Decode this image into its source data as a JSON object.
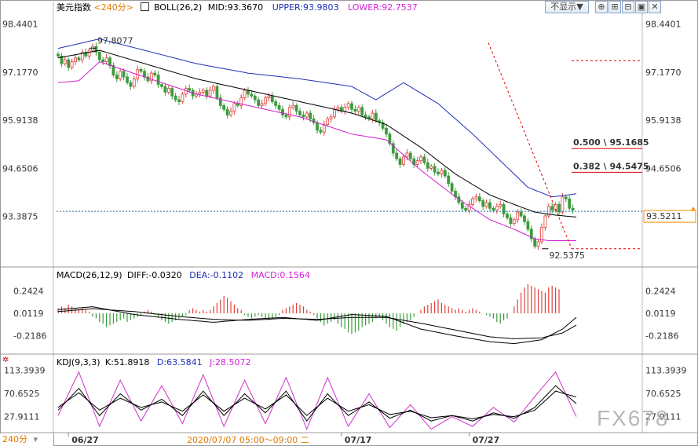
{
  "header": {
    "symbol": "美元指数",
    "period": "<240分>",
    "boll_label": "BOLL(26,2)",
    "mid_label": "MID:93.3670",
    "upper_label": "UPPER:93.9803",
    "lower_label": "LOWER:92.7537",
    "show_button": "不显示▼",
    "tool_icons": [
      "crosshair-icon",
      "zoom-in-icon",
      "zoom-out-icon",
      "window-icon",
      "close-icon"
    ]
  },
  "macd_header": {
    "title": "MACD(26,12,9)",
    "diff": "DIFF:-0.0320",
    "dea": "DEA:-0.1102",
    "macd": "MACD:0.1564"
  },
  "kdj_header": {
    "title": "KDJ(9,3,3)",
    "k": "K:51.8918",
    "d": "D:63.5841",
    "j": "J:28.5072"
  },
  "bottom_bar": {
    "period_button": "240分",
    "time_cursor": "2020/07/07 05:00～09:00 二"
  },
  "watermark": "FX678",
  "colors": {
    "up": "#e0413c",
    "down": "#3c9b3c",
    "mid": "#000000",
    "upper": "#1e2fb5",
    "lower": "#d41fd4",
    "fib": "#e00000",
    "current": "#1d6fa8",
    "current_tag": "#ff8c00",
    "diff": "#000000",
    "dea": "#000000",
    "k": "#000000",
    "d": "#000000",
    "j": "#cc33cc"
  },
  "chart_data": [
    {
      "type": "candlestick",
      "name": "美元指数",
      "ylim": [
        92.1,
        98.7
      ],
      "y_ticks": [
        "98.4401",
        "97.1770",
        "95.9138",
        "94.6506",
        "93.3875"
      ],
      "y_tick_values": [
        98.4401,
        97.177,
        95.9138,
        94.6506,
        93.3875
      ],
      "x_ticks": [
        "06/27",
        "07/17",
        "07/27"
      ],
      "x_tick_index": [
        3,
        82,
        119
      ],
      "closes": [
        97.6,
        97.4,
        97.5,
        97.3,
        97.45,
        97.55,
        97.5,
        97.7,
        97.6,
        97.75,
        97.85,
        97.7,
        97.5,
        97.45,
        97.55,
        97.35,
        97.1,
        97.0,
        97.2,
        97.05,
        96.9,
        96.8,
        97.0,
        97.25,
        97.2,
        97.05,
        96.95,
        97.15,
        97.1,
        96.85,
        96.8,
        96.65,
        96.75,
        96.55,
        96.45,
        96.4,
        96.6,
        96.75,
        96.7,
        96.55,
        96.6,
        96.65,
        96.7,
        96.55,
        96.7,
        96.8,
        96.5,
        96.3,
        96.2,
        96.05,
        96.15,
        96.35,
        96.3,
        96.5,
        96.7,
        96.6,
        96.55,
        96.45,
        96.3,
        96.35,
        96.5,
        96.55,
        96.4,
        96.3,
        96.2,
        96.05,
        96.0,
        96.25,
        96.3,
        96.15,
        96.05,
        96.0,
        96.1,
        95.95,
        95.85,
        95.65,
        95.6,
        95.8,
        95.95,
        96.0,
        96.2,
        96.25,
        96.15,
        96.25,
        96.35,
        96.2,
        96.15,
        96.25,
        96.05,
        96.0,
        95.95,
        96.1,
        95.9,
        95.85,
        95.7,
        95.55,
        95.3,
        95.05,
        94.9,
        94.75,
        94.95,
        95.05,
        94.9,
        94.75,
        94.85,
        94.95,
        94.8,
        94.65,
        94.7,
        94.55,
        94.5,
        94.6,
        94.45,
        94.25,
        94.05,
        93.9,
        93.75,
        93.6,
        93.55,
        93.7,
        93.85,
        93.9,
        93.8,
        93.65,
        93.75,
        93.6,
        93.55,
        93.65,
        93.7,
        93.45,
        93.35,
        93.2,
        93.3,
        93.5,
        93.4,
        93.25,
        93.05,
        92.8,
        92.6,
        92.72,
        93.1,
        93.4,
        93.65,
        93.55,
        93.7,
        93.5,
        93.9,
        93.85,
        93.6,
        93.55
      ],
      "bands": {
        "mid": [
          [
            0,
            97.55
          ],
          [
            12,
            97.75
          ],
          [
            25,
            97.4
          ],
          [
            40,
            97.0
          ],
          [
            55,
            96.7
          ],
          [
            70,
            96.4
          ],
          [
            85,
            96.1
          ],
          [
            95,
            95.8
          ],
          [
            105,
            95.2
          ],
          [
            115,
            94.5
          ],
          [
            125,
            93.95
          ],
          [
            132,
            93.7
          ],
          [
            138,
            93.5
          ],
          [
            144,
            93.42
          ],
          [
            150,
            93.37
          ]
        ],
        "upper": [
          [
            0,
            97.8
          ],
          [
            12,
            98.05
          ],
          [
            25,
            97.75
          ],
          [
            40,
            97.4
          ],
          [
            55,
            97.15
          ],
          [
            70,
            97.0
          ],
          [
            85,
            96.8
          ],
          [
            92,
            96.45
          ],
          [
            100,
            96.9
          ],
          [
            110,
            96.35
          ],
          [
            120,
            95.55
          ],
          [
            128,
            94.85
          ],
          [
            136,
            94.15
          ],
          [
            143,
            93.9
          ],
          [
            150,
            93.98
          ]
        ],
        "lower": [
          [
            0,
            96.9
          ],
          [
            6,
            96.95
          ],
          [
            12,
            97.45
          ],
          [
            25,
            97.05
          ],
          [
            40,
            96.6
          ],
          [
            55,
            96.3
          ],
          [
            70,
            96.0
          ],
          [
            85,
            95.55
          ],
          [
            95,
            95.4
          ],
          [
            105,
            94.6
          ],
          [
            115,
            93.9
          ],
          [
            125,
            93.3
          ],
          [
            132,
            93.05
          ],
          [
            138,
            92.8
          ],
          [
            142,
            92.75
          ],
          [
            150,
            92.75
          ]
        ]
      },
      "annotations": [
        {
          "label": "97.8077",
          "value": 97.8077,
          "index": 10,
          "kind": "high"
        },
        {
          "label": "92.5375",
          "value": 92.5375,
          "index": 141,
          "kind": "low"
        },
        {
          "label": "0.500 \\ 95.1685",
          "value": 95.1685,
          "kind": "fib"
        },
        {
          "label": "0.382 \\ 94.5475",
          "value": 94.5475,
          "kind": "fib"
        }
      ],
      "fib_levels": [
        97.8077,
        92.5375
      ],
      "current_price": 93.5211,
      "current_label": "93.5211"
    },
    {
      "type": "line+bar",
      "name": "MACD(26,12,9)",
      "ylim": [
        -0.4,
        0.36
      ],
      "y_ticks": [
        "0.2424",
        "0.0119",
        "-0.2186"
      ],
      "y_tick_values": [
        0.2424,
        0.0119,
        -0.2186
      ],
      "series": [
        {
          "name": "DIFF",
          "points": [
            [
              0,
              0.05
            ],
            [
              10,
              0.08
            ],
            [
              22,
              0.0
            ],
            [
              35,
              -0.05
            ],
            [
              45,
              -0.08
            ],
            [
              55,
              -0.05
            ],
            [
              65,
              -0.03
            ],
            [
              75,
              -0.06
            ],
            [
              85,
              0.0
            ],
            [
              95,
              -0.02
            ],
            [
              105,
              -0.15
            ],
            [
              115,
              -0.22
            ],
            [
              125,
              -0.28
            ],
            [
              132,
              -0.3
            ],
            [
              140,
              -0.26
            ],
            [
              146,
              -0.15
            ],
            [
              150,
              -0.03
            ]
          ]
        },
        {
          "name": "DEA",
          "points": [
            [
              0,
              0.03
            ],
            [
              10,
              0.06
            ],
            [
              22,
              0.03
            ],
            [
              35,
              -0.02
            ],
            [
              45,
              -0.05
            ],
            [
              55,
              -0.06
            ],
            [
              65,
              -0.04
            ],
            [
              75,
              -0.05
            ],
            [
              85,
              -0.03
            ],
            [
              95,
              -0.03
            ],
            [
              105,
              -0.09
            ],
            [
              115,
              -0.16
            ],
            [
              125,
              -0.23
            ],
            [
              132,
              -0.25
            ],
            [
              140,
              -0.24
            ],
            [
              146,
              -0.19
            ],
            [
              150,
              -0.11
            ]
          ]
        }
      ],
      "bars": [
        0.03,
        0.04,
        0.03,
        0.05,
        0.04,
        0.03,
        0.02,
        0.03,
        0.02,
        0.01,
        -0.02,
        -0.03,
        -0.05,
        -0.06,
        -0.08,
        -0.07,
        -0.06,
        -0.05,
        -0.04,
        -0.03,
        -0.05,
        -0.04,
        -0.03,
        -0.02,
        -0.01,
        0.01,
        0.02,
        0.01,
        -0.01,
        -0.02,
        -0.04,
        -0.05,
        -0.06,
        -0.05,
        -0.04,
        -0.03,
        -0.02,
        -0.01,
        0.02,
        0.03,
        0.02,
        0.01,
        0.02,
        0.01,
        0.02,
        0.04,
        0.06,
        0.08,
        0.1,
        0.09,
        0.07,
        0.05,
        0.03,
        0.02,
        -0.01,
        -0.02,
        -0.03,
        -0.02,
        -0.01,
        -0.02,
        -0.03,
        -0.04,
        -0.03,
        -0.02,
        -0.01,
        0.02,
        0.03,
        0.04,
        0.05,
        0.06,
        0.05,
        0.04,
        0.02,
        0.01,
        -0.01,
        -0.03,
        -0.05,
        -0.07,
        -0.06,
        -0.05,
        -0.04,
        -0.06,
        -0.08,
        -0.09,
        -0.11,
        -0.12,
        -0.11,
        -0.1,
        -0.08,
        -0.07,
        -0.06,
        -0.05,
        -0.03,
        -0.02,
        -0.04,
        -0.06,
        -0.08,
        -0.09,
        -0.1,
        -0.08,
        -0.06,
        -0.05,
        -0.04,
        -0.02,
        0.0,
        0.02,
        0.04,
        0.05,
        0.06,
        0.07,
        0.08,
        0.06,
        0.05,
        0.04,
        0.03,
        0.02,
        0.03,
        0.02,
        0.01,
        0.02,
        0.03,
        0.02,
        0.01,
        0.0,
        -0.01,
        -0.02,
        -0.03,
        -0.05,
        -0.06,
        -0.04,
        -0.03,
        0.0,
        0.04,
        0.08,
        0.12,
        0.15,
        0.17,
        0.16,
        0.15,
        0.14,
        0.13,
        0.12,
        0.15,
        0.16,
        0.15,
        0.14
      ]
    },
    {
      "type": "line",
      "name": "KDJ(9,3,3)",
      "ylim": [
        0,
        130
      ],
      "y_ticks": [
        "113.3939",
        "70.6525",
        "27.9111"
      ],
      "y_tick_values": [
        113.3939,
        70.6525,
        27.9111
      ],
      "series": [
        {
          "name": "K",
          "points": [
            [
              0,
              40
            ],
            [
              6,
              80
            ],
            [
              12,
              30
            ],
            [
              18,
              70
            ],
            [
              24,
              40
            ],
            [
              30,
              60
            ],
            [
              36,
              30
            ],
            [
              42,
              75
            ],
            [
              48,
              30
            ],
            [
              54,
              70
            ],
            [
              60,
              35
            ],
            [
              66,
              75
            ],
            [
              72,
              20
            ],
            [
              78,
              70
            ],
            [
              84,
              30
            ],
            [
              90,
              55
            ],
            [
              96,
              25
            ],
            [
              102,
              40
            ],
            [
              108,
              20
            ],
            [
              114,
              30
            ],
            [
              120,
              20
            ],
            [
              126,
              35
            ],
            [
              132,
              25
            ],
            [
              138,
              45
            ],
            [
              144,
              85
            ],
            [
              150,
              52
            ]
          ]
        },
        {
          "name": "D",
          "points": [
            [
              0,
              45
            ],
            [
              6,
              72
            ],
            [
              12,
              40
            ],
            [
              18,
              62
            ],
            [
              24,
              45
            ],
            [
              30,
              55
            ],
            [
              36,
              38
            ],
            [
              42,
              68
            ],
            [
              48,
              38
            ],
            [
              54,
              62
            ],
            [
              60,
              42
            ],
            [
              66,
              68
            ],
            [
              72,
              30
            ],
            [
              78,
              62
            ],
            [
              84,
              38
            ],
            [
              90,
              50
            ],
            [
              96,
              32
            ],
            [
              102,
              38
            ],
            [
              108,
              26
            ],
            [
              114,
              30
            ],
            [
              120,
              24
            ],
            [
              126,
              32
            ],
            [
              132,
              28
            ],
            [
              138,
              40
            ],
            [
              144,
              75
            ],
            [
              150,
              64
            ]
          ]
        },
        {
          "name": "J",
          "points": [
            [
              0,
              30
            ],
            [
              6,
              110
            ],
            [
              12,
              10
            ],
            [
              18,
              95
            ],
            [
              24,
              20
            ],
            [
              30,
              85
            ],
            [
              36,
              15
            ],
            [
              42,
              105
            ],
            [
              48,
              10
            ],
            [
              54,
              95
            ],
            [
              60,
              15
            ],
            [
              66,
              100
            ],
            [
              72,
              5
            ],
            [
              78,
              100
            ],
            [
              84,
              10
            ],
            [
              90,
              70
            ],
            [
              96,
              8
            ],
            [
              102,
              50
            ],
            [
              108,
              5
            ],
            [
              114,
              28
            ],
            [
              120,
              10
            ],
            [
              126,
              45
            ],
            [
              132,
              18
            ],
            [
              138,
              65
            ],
            [
              144,
              110
            ],
            [
              150,
              28
            ]
          ]
        }
      ]
    }
  ]
}
